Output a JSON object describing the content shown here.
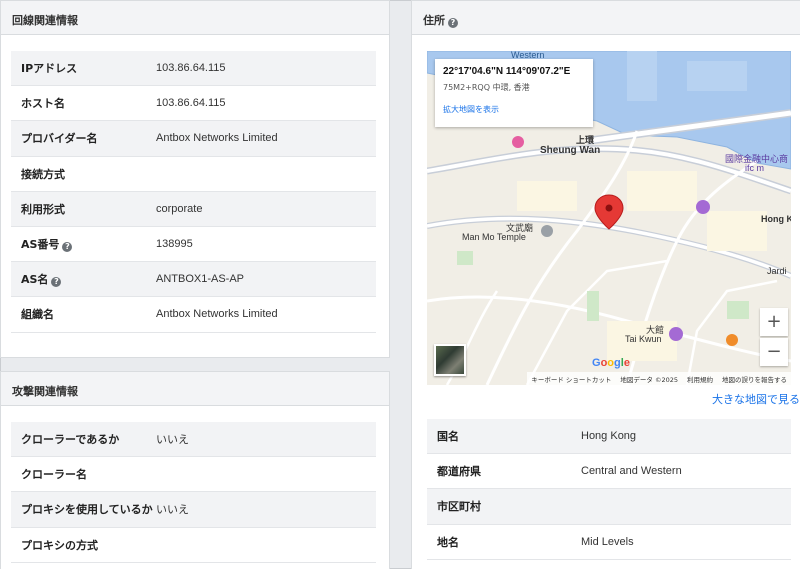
{
  "network": {
    "title": "回線関連情報",
    "rows": [
      {
        "label": "IPアドレス",
        "value": "103.86.64.115",
        "help": false
      },
      {
        "label": "ホスト名",
        "value": "103.86.64.115",
        "help": false
      },
      {
        "label": "プロバイダー名",
        "value": "Antbox Networks Limited",
        "help": false
      },
      {
        "label": "接続方式",
        "value": "",
        "help": false
      },
      {
        "label": "利用形式",
        "value": "corporate",
        "help": false
      },
      {
        "label": "AS番号",
        "value": "138995",
        "help": true
      },
      {
        "label": "AS名",
        "value": "ANTBOX1-AS-AP",
        "help": true
      },
      {
        "label": "組織名",
        "value": "Antbox Networks Limited",
        "help": false
      }
    ]
  },
  "attack": {
    "title": "攻撃関連情報",
    "rows": [
      {
        "label": "クローラーであるか",
        "value": "いいえ"
      },
      {
        "label": "クローラー名",
        "value": ""
      },
      {
        "label": "プロキシを使用しているか",
        "value": "いいえ"
      },
      {
        "label": "プロキシの方式",
        "value": ""
      }
    ]
  },
  "address": {
    "title": "住所",
    "help_icon": "?",
    "bigger_map_link": "大きな地図で見る",
    "map": {
      "coords": "22°17'04.6\"N 114°09'07.2\"E",
      "plus_code": "75M2+RQQ 中環, 香港",
      "view_larger": "拡大地図を表示",
      "zoom_in": "+",
      "zoom_out": "−",
      "google": "Google",
      "attribution": [
        "キーボード ショートカット",
        "地図データ ©2025",
        "利用規約",
        "地図の誤りを報告する"
      ],
      "labels": {
        "western": "Western",
        "sheung_wan_jp": "上環",
        "sheung_wan": "Sheung Wan",
        "temple_jp": "文武廟",
        "temple": "Man Mo Temple",
        "tai_kwun_jp": "大館",
        "tai_kwun": "Tai Kwun",
        "ifc_jp": "國際金融中心商",
        "ifc": "ifc m",
        "hongkong": "Hong K",
        "jardine": "Jardi"
      }
    },
    "rows": [
      {
        "label": "国名",
        "value": "Hong Kong"
      },
      {
        "label": "都道府県",
        "value": "Central and Western"
      },
      {
        "label": "市区町村",
        "value": ""
      },
      {
        "label": "地名",
        "value": "Mid Levels"
      }
    ]
  }
}
